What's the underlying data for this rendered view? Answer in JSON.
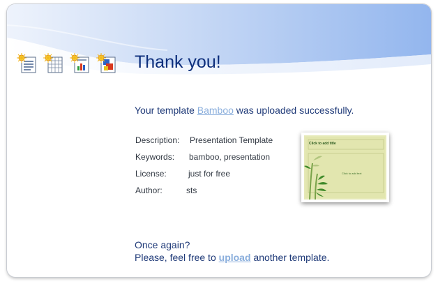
{
  "page": {
    "title": "Thank you!"
  },
  "icons": [
    {
      "name": "new-document-icon"
    },
    {
      "name": "new-spreadsheet-icon"
    },
    {
      "name": "new-chart-document-icon"
    },
    {
      "name": "new-presentation-icon"
    }
  ],
  "upload_message": {
    "prefix": "Your template ",
    "template_name": "Bamboo",
    "suffix": " was uploaded successfully."
  },
  "details": [
    {
      "key": "Description:",
      "value": "Presentation Template"
    },
    {
      "key": "Keywords:",
      "value": "bamboo, presentation"
    },
    {
      "key": "License:",
      "value": "just for free"
    },
    {
      "key": "Author:",
      "value": "sts"
    }
  ],
  "thumbnail": {
    "title_placeholder": "Click to add title",
    "body_placeholder": "Click to add text"
  },
  "closing": {
    "line1": "Once again?",
    "line2_prefix": "Please, feel free to ",
    "upload_link": "upload",
    "line2_suffix": " another template."
  },
  "colors": {
    "title": "#0e2f7c",
    "text": "#1f3a78",
    "link": "#8aaedc",
    "header_blue": "#9dbcf0"
  }
}
